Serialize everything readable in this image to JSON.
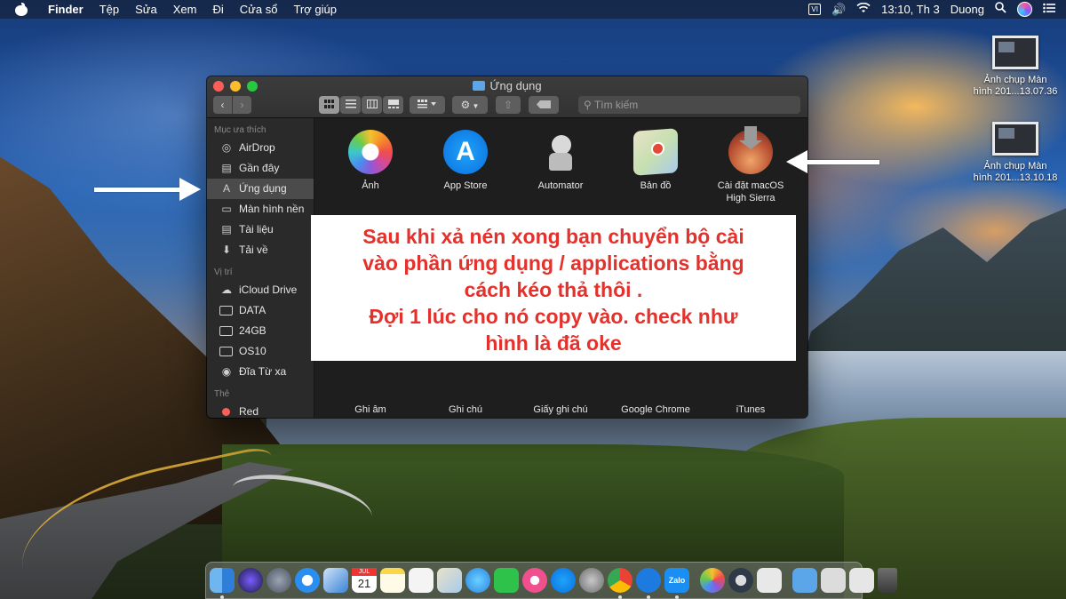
{
  "menubar": {
    "app_name": "Finder",
    "menus": [
      "Tệp",
      "Sửa",
      "Xem",
      "Đi",
      "Cửa sổ",
      "Trợ giúp"
    ],
    "input_badge": "VI",
    "clock": "13:10, Th 3",
    "user": "Duong"
  },
  "desktop_icons": [
    {
      "label_line1": "Ảnh chụp Màn",
      "label_line2": "hình 201...13.07.36"
    },
    {
      "label_line1": "Ảnh chụp Màn",
      "label_line2": "hình 201...13.10.18"
    }
  ],
  "finder": {
    "title": "Ứng dụng",
    "search_placeholder": "Tìm kiếm",
    "sidebar": {
      "favorites_header": "Mục ưa thích",
      "favorites": [
        {
          "label": "AirDrop",
          "icon": "airdrop-icon"
        },
        {
          "label": "Gần đây",
          "icon": "recents-icon"
        },
        {
          "label": "Ứng dụng",
          "icon": "applications-icon",
          "selected": true
        },
        {
          "label": "Màn hình nền",
          "icon": "desktop-icon"
        },
        {
          "label": "Tài liệu",
          "icon": "documents-icon"
        },
        {
          "label": "Tải về",
          "icon": "downloads-icon"
        }
      ],
      "locations_header": "Vị trí",
      "locations": [
        {
          "label": "iCloud Drive",
          "icon": "icloud-icon"
        },
        {
          "label": "DATA",
          "icon": "disk-icon"
        },
        {
          "label": "24GB",
          "icon": "disk-icon"
        },
        {
          "label": "OS10",
          "icon": "disk-icon"
        },
        {
          "label": "Đĩa Từ xa",
          "icon": "remote-disc-icon"
        }
      ],
      "tags_header": "Thẻ",
      "tags": [
        {
          "label": "Red",
          "color": "#fc5f57"
        }
      ]
    },
    "apps_row1": [
      {
        "label": "Ảnh",
        "icon": "photos-icon"
      },
      {
        "label": "App Store",
        "icon": "app-store-icon"
      },
      {
        "label": "Automator",
        "icon": "automator-icon"
      },
      {
        "label": "Bản đồ",
        "icon": "maps-icon"
      },
      {
        "label": "Cài đặt macOS",
        "label2": "High Sierra",
        "icon": "installer-icon"
      }
    ],
    "apps_row3": [
      {
        "label": "Ghi âm"
      },
      {
        "label": "Ghi chú"
      },
      {
        "label": "Giấy ghi chú"
      },
      {
        "label": "Google Chrome"
      },
      {
        "label": "iTunes"
      }
    ]
  },
  "annotation": {
    "lines": [
      "Sau khi xả nén xong bạn chuyển bộ cài",
      "vào phần ứng dụng / applications bằng",
      "cách kéo thả thôi .",
      "Đợi 1 lúc cho nó copy vào. check như",
      "hình là đã oke"
    ],
    "color": "#e4312b"
  },
  "dock": {
    "calendar_month": "JUL",
    "calendar_day": "21",
    "zalo_label": "Zalo"
  }
}
